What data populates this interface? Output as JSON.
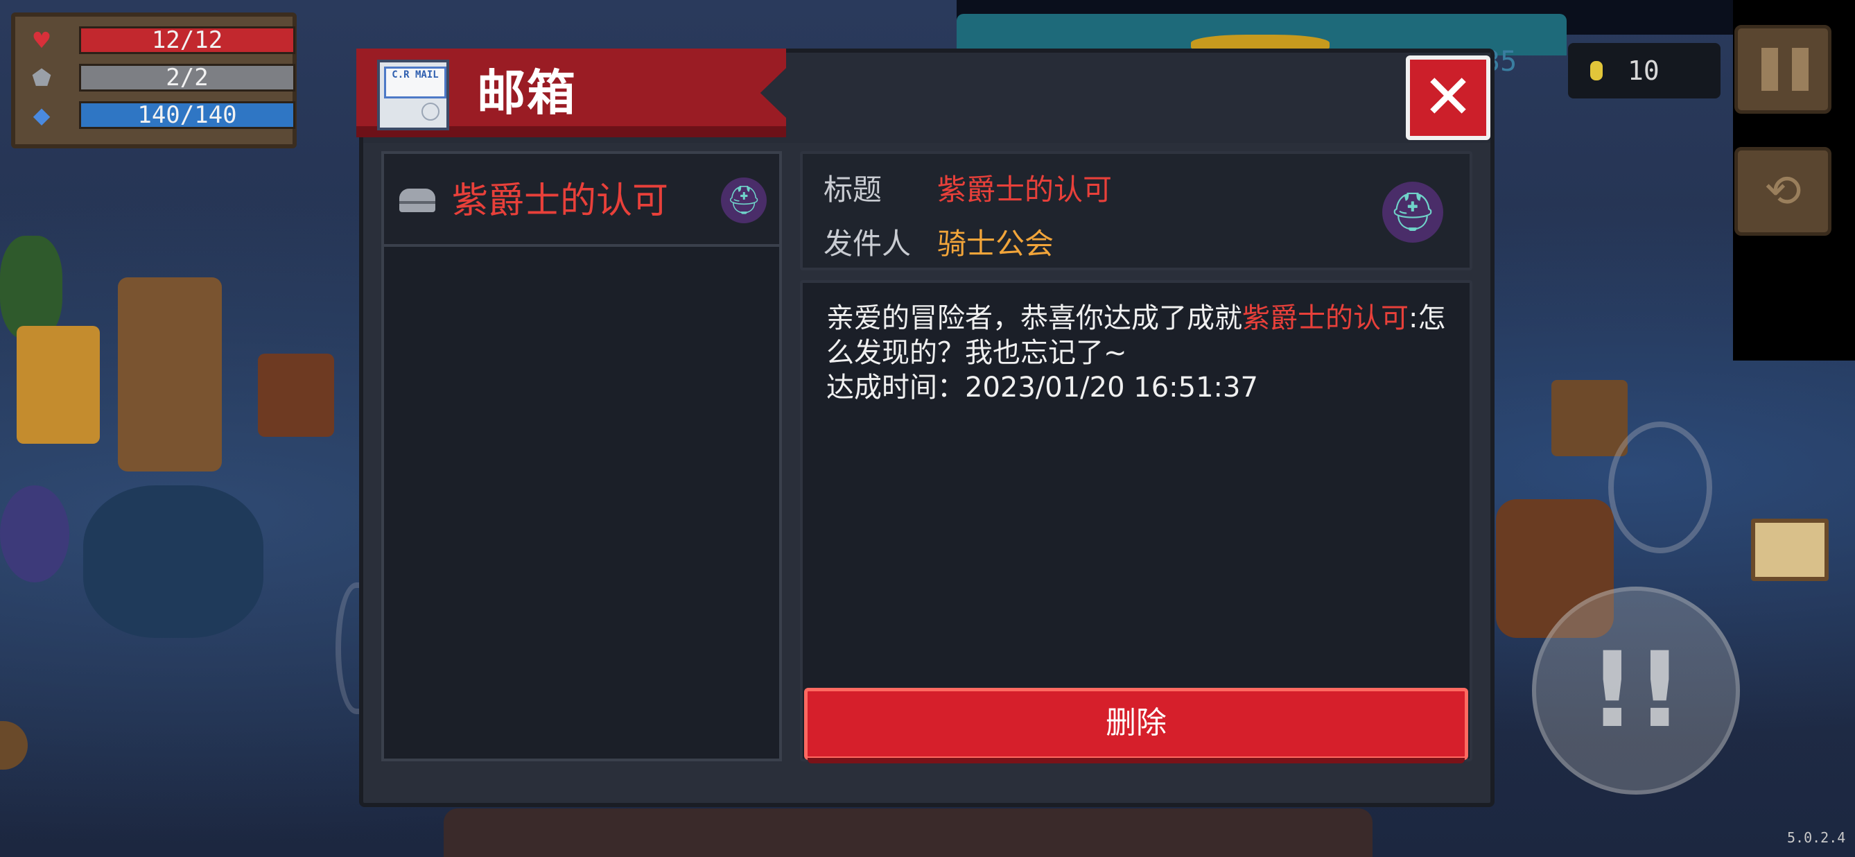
{
  "hud": {
    "hp": "12/12",
    "armor": "2/2",
    "energy": "140/140",
    "coins": "10",
    "partial_counter": "35",
    "version": "5.0.2.4"
  },
  "mailbox": {
    "title": "邮箱",
    "stamp_text": "C.R MAIL",
    "list": [
      {
        "title": "紫爵士的认可"
      }
    ],
    "detail": {
      "title_label": "标题",
      "title_value": "紫爵士的认可",
      "sender_label": "发件人",
      "sender_value": "骑士公会",
      "body_prefix": "亲爱的冒险者，恭喜你达成了成就",
      "body_highlight": "紫爵士的认可",
      "body_suffix": ":怎么发现的？我也忘记了~",
      "achieved_label": "达成时间：",
      "achieved_time": "2023/01/20 16:51:37"
    },
    "delete_label": "删除"
  },
  "colors": {
    "accent_red": "#e8403a",
    "sender_orange": "#f2a53a",
    "banner_red": "#9a1c24",
    "button_red": "#d61f2b"
  },
  "icons": [
    "heart-icon",
    "shield-icon",
    "energy-gem-icon",
    "mail-icon",
    "envelope-icon",
    "knight-helmet-icon",
    "close-icon",
    "coin-icon",
    "pause-icon",
    "swap-weapon-icon",
    "skill-icon"
  ]
}
